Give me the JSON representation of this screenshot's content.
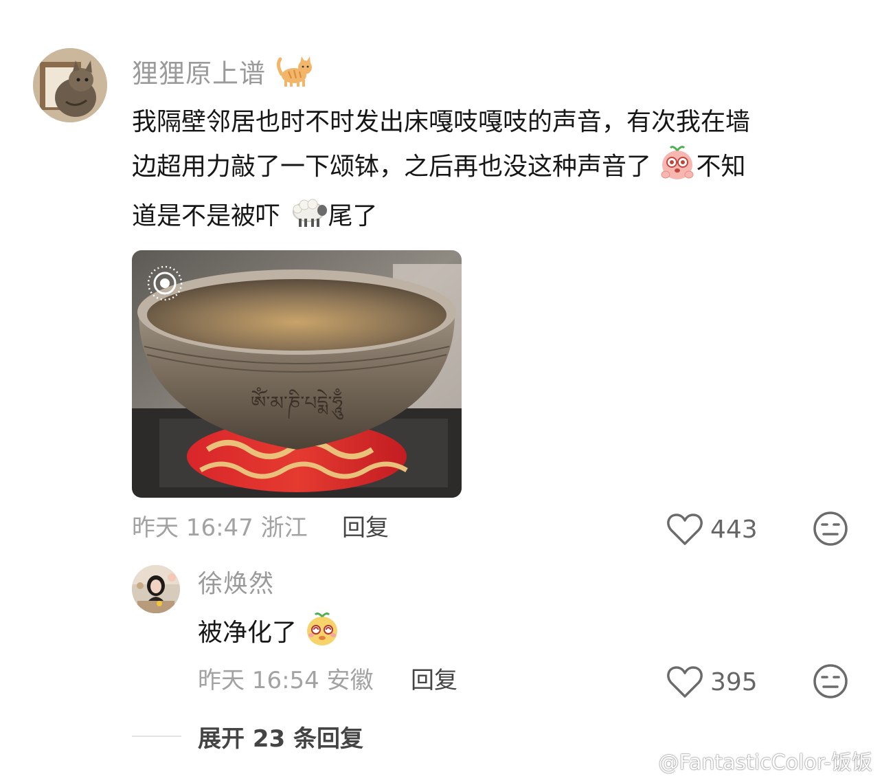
{
  "comment": {
    "username": "狸狸原上谱",
    "username_emoji": "cat-emoji",
    "text_line1": "我隔壁邻居也时不时发出床嘎吱嘎吱的声音，有次我在墙",
    "text_line2a": "边超用力敲了一下颂钵，之后再也没这种声音了",
    "text_line2b": "不知",
    "text_line3a": "道是不是被吓",
    "text_line3b": "尾了",
    "photo_inscription": "ཨོཾ་མ་ཎི་པདྨེ་ཧཱུྃ",
    "meta": "昨天 16:47 浙江",
    "reply_label": "回复",
    "likes": "443"
  },
  "reply": {
    "username": "徐焕然",
    "text": "被净化了",
    "meta": "昨天 16:54 安徽",
    "reply_label": "回复",
    "likes": "395"
  },
  "expand": {
    "label": "展开 23 条回复"
  },
  "watermark": {
    "text": "@FantasticColor-饭饭"
  },
  "colors": {
    "meta_gray": "#a2a2a2",
    "username_gray": "#9a9a9a",
    "text": "#161616"
  }
}
